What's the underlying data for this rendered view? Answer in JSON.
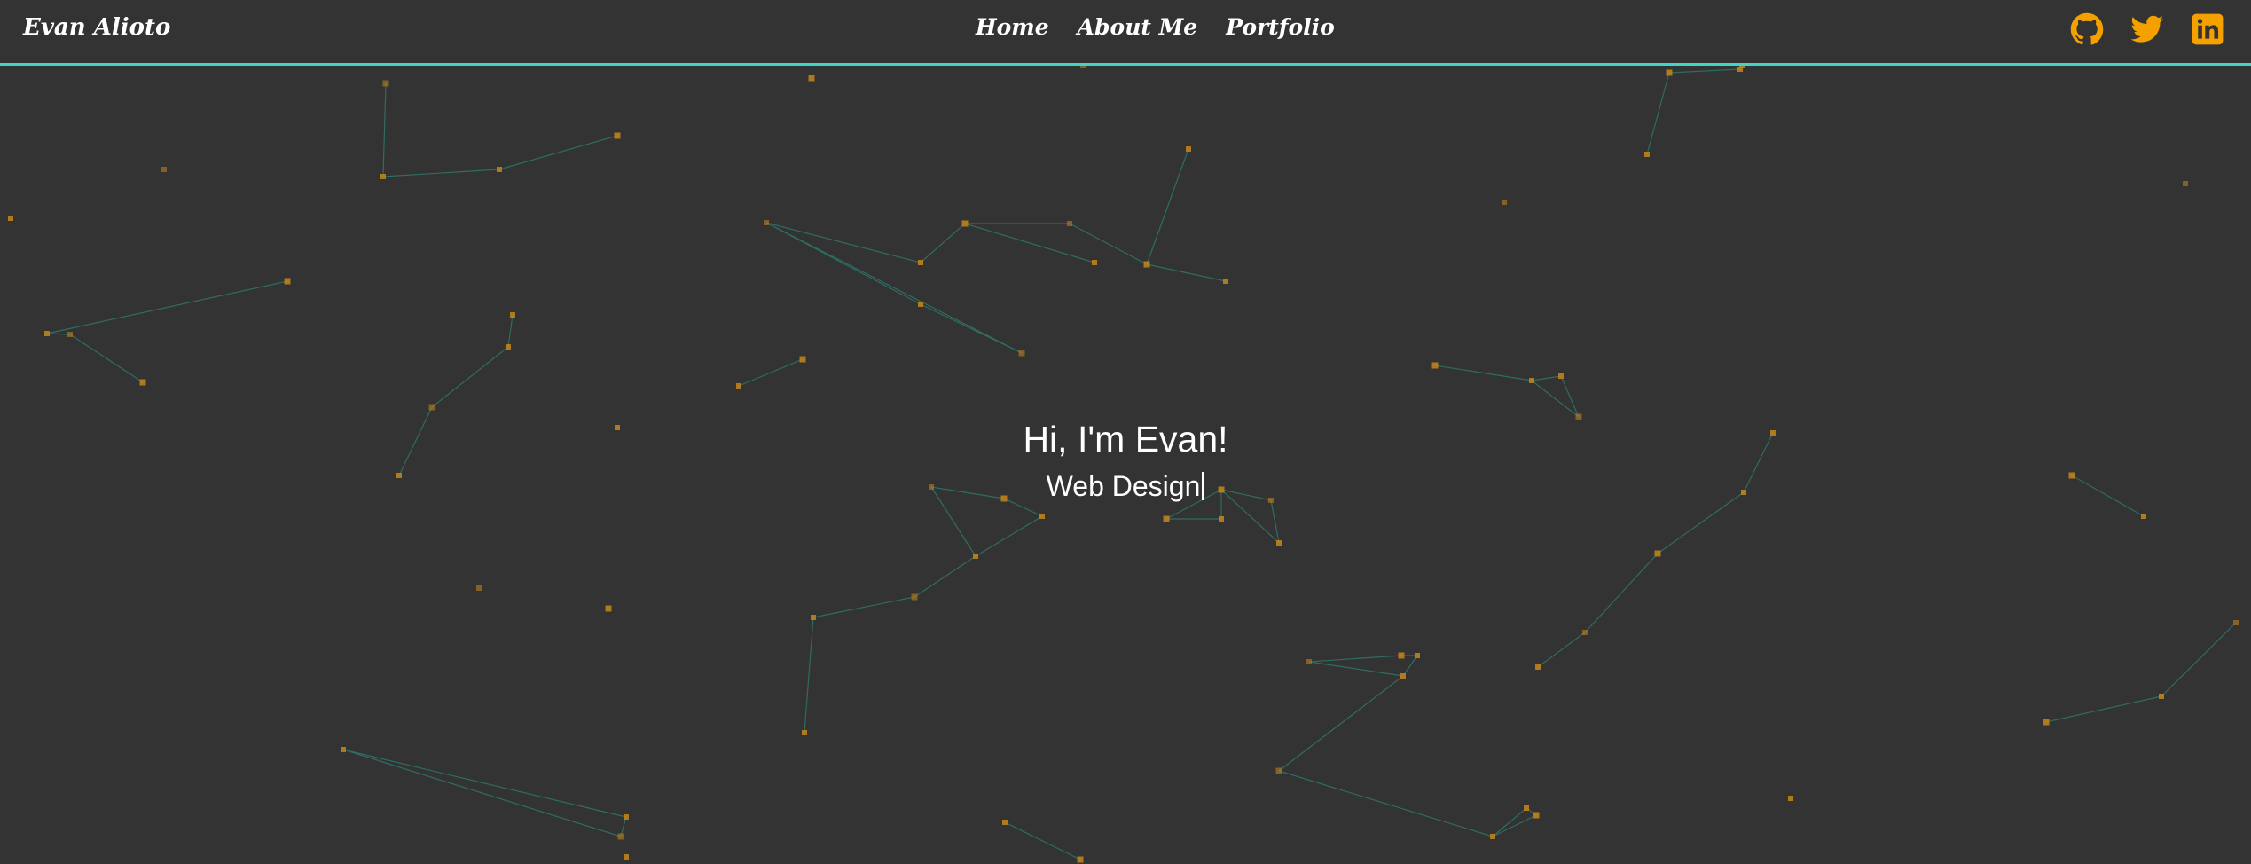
{
  "brand": {
    "name": "Evan Alioto"
  },
  "nav": {
    "items": [
      {
        "label": "Home"
      },
      {
        "label": "About Me"
      },
      {
        "label": "Portfolio"
      }
    ]
  },
  "socials": [
    {
      "icon": "github-icon"
    },
    {
      "icon": "twitter-icon"
    },
    {
      "icon": "linkedin-icon"
    }
  ],
  "hero": {
    "title": "Hi, I'm Evan!",
    "typed_text": "Web Design"
  },
  "colors": {
    "background": "#333333",
    "accent_line": "#3fd6c6",
    "icon": "#f4a100",
    "particle_dot": "#c8861a",
    "particle_line": "#2e7f72",
    "text": "#ffffff"
  }
}
